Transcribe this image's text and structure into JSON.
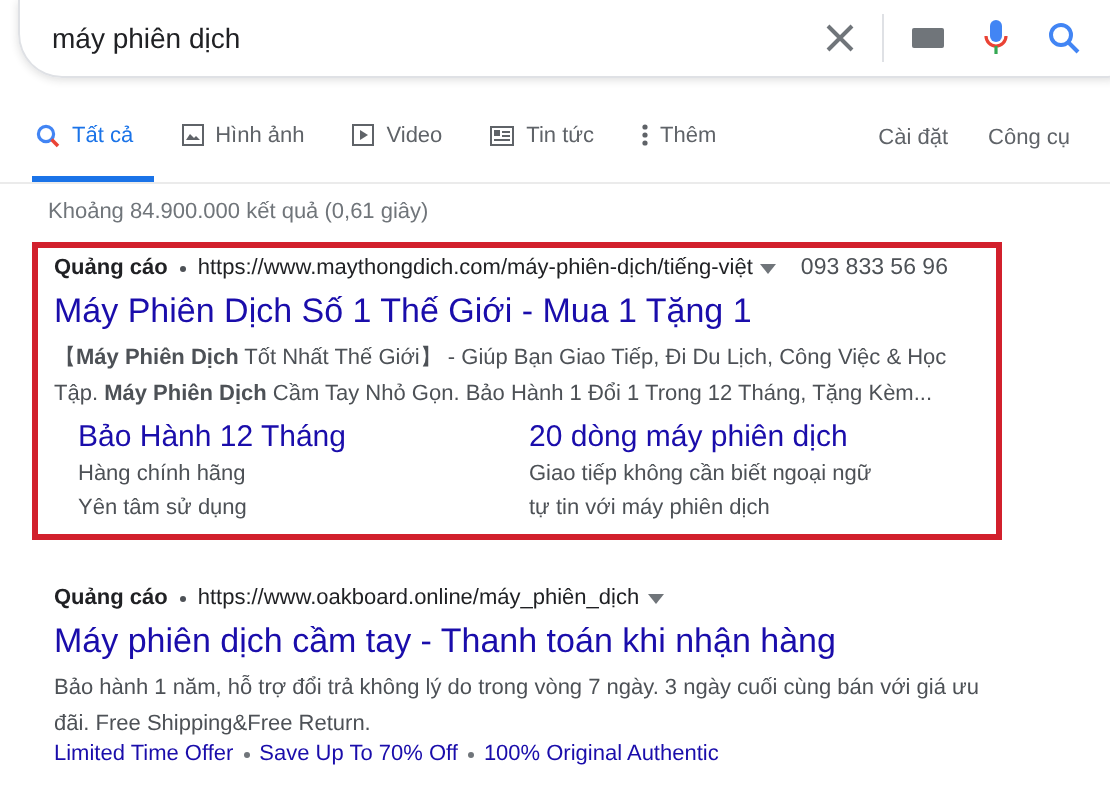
{
  "search": {
    "value": "máy phiên dịch"
  },
  "tabs": [
    {
      "label": "Tất cả",
      "kind": "search",
      "selected": true
    },
    {
      "label": "Hình ảnh",
      "kind": "image",
      "selected": false
    },
    {
      "label": "Video",
      "kind": "video",
      "selected": false
    },
    {
      "label": "Tin tức",
      "kind": "news",
      "selected": false
    },
    {
      "label": "Thêm",
      "kind": "more",
      "selected": false
    }
  ],
  "tools": [
    "Cài đặt",
    "Công cụ"
  ],
  "result_stats": "Khoảng 84.900.000 kết quả (0,61 giây)",
  "ads": [
    {
      "highlighted": true,
      "label": "Quảng cáo",
      "url": "https://www.maythongdich.com/máy-phiên-dịch/tiếng-việt",
      "phone": "093 833 56 96",
      "title": "Máy Phiên Dịch Số 1 Thế Giới - Mua 1 Tặng 1",
      "snippet": "【**Máy Phiên Dịch** Tốt Nhất Thế Giới】 - Giúp Bạn Giao Tiếp, Đi Du Lịch, Công Việc & Học Tập. **Máy Phiên Dịch** Cầm Tay Nhỏ Gọn. Bảo Hành 1 Đổi 1 Trong 12 Tháng, Tặng Kèm...",
      "sitelinks": [
        {
          "title": "Bảo Hành 12 Tháng",
          "lines": [
            "Hàng chính hãng",
            "Yên tâm sử dụng"
          ]
        },
        {
          "title": "20 dòng máy phiên dịch",
          "lines": [
            "Giao tiếp không cần biết ngoại ngữ",
            "tự tin với máy phiên dịch"
          ]
        }
      ]
    },
    {
      "highlighted": false,
      "label": "Quảng cáo",
      "url": "https://www.oakboard.online/máy_phiên_dịch",
      "title": "Máy phiên dịch cầm tay - Thanh toán khi nhận hàng",
      "snippet": "Bảo hành 1 năm, hỗ trợ đổi trả không lý do trong vòng 7 ngày. 3 ngày cuối cùng bán với giá ưu đãi. Free Shipping&Free Return.",
      "links": [
        "Limited Time Offer",
        "Save Up To 70% Off",
        "100% Original Authentic"
      ]
    }
  ]
}
